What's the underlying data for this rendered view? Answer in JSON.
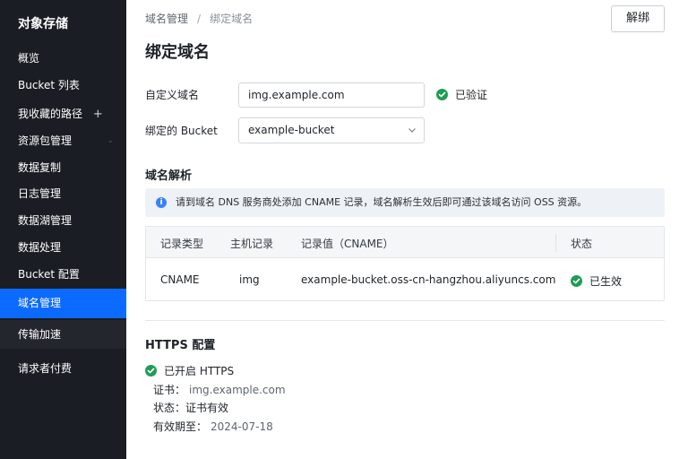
{
  "sidebar": {
    "product_title": "对象存储",
    "items": [
      {
        "label": "概览"
      },
      {
        "label": "Bucket 列表"
      },
      {
        "label": "我收藏的路径",
        "suffix": "+"
      },
      {
        "label": "资源包管理"
      },
      {
        "label": "数据复制"
      },
      {
        "label": "日志管理"
      },
      {
        "label": "数据湖管理"
      },
      {
        "label": "数据处理"
      },
      {
        "label": "Bucket 配置"
      },
      {
        "label": "域名管理",
        "active": true
      },
      {
        "label": "传输加速"
      },
      {
        "label": "请求者付费"
      }
    ]
  },
  "header": {
    "breadcrumb": {
      "parent": "域名管理",
      "separator": "/",
      "current": "绑定域名"
    },
    "unbind_label": "解绑",
    "page_title": "绑定域名"
  },
  "form": {
    "domain_label": "自定义域名",
    "domain_value": "img.example.com",
    "verified_text": "已验证",
    "bucket_label": "绑定的 Bucket",
    "bucket_value": "example-bucket"
  },
  "dns": {
    "section_title": "域名解析",
    "info_text": "请到域名 DNS 服务商处添加 CNAME 记录，域名解析生效后即可通过该域名访问 OSS 资源。",
    "columns": [
      "记录类型",
      "主机记录",
      "记录值（CNAME）",
      "状态"
    ],
    "rows": [
      {
        "type": "CNAME",
        "host": "img",
        "value": "example-bucket.oss-cn-hangzhou.aliyuncs.com",
        "status": "已生效"
      }
    ]
  },
  "https": {
    "section_title": "HTTPS 配置",
    "enabled_text": "已开启 HTTPS",
    "cert_label": "证书：",
    "cert_value": "img.example.com",
    "status_label": "状态：",
    "status_value": "证书有效",
    "expiry_label": "有效期至：",
    "expiry_value": "2024-07-18"
  },
  "colors": {
    "sidebar_bg": "#1b1d24",
    "active_nav": "#0b6bff",
    "success": "#1f9d55",
    "info": "#3b82f6"
  }
}
